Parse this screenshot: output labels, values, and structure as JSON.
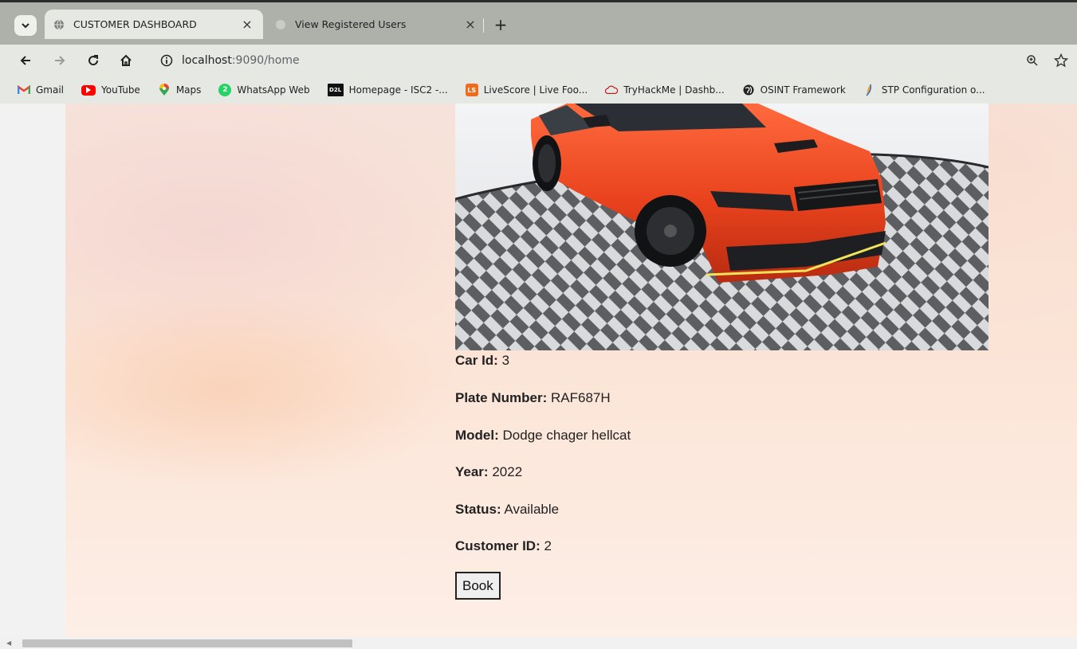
{
  "browser": {
    "tabs": [
      {
        "label": "CUSTOMER DASHBOARD",
        "active": true
      },
      {
        "label": "View Registered Users",
        "active": false
      }
    ],
    "close_glyph": "×",
    "new_tab_glyph": "+",
    "url_host": "localhost",
    "url_path": ":9090/home"
  },
  "bookmarks": [
    {
      "label": "Gmail",
      "icon": "gmail-icon",
      "color": "#ea4335"
    },
    {
      "label": "YouTube",
      "icon": "youtube-icon",
      "color": "#ff0000"
    },
    {
      "label": "Maps",
      "icon": "maps-icon",
      "color": "#fbbc04"
    },
    {
      "label": "WhatsApp Web",
      "icon": "whatsapp-icon",
      "color": "#25d366",
      "glyph": "2"
    },
    {
      "label": "Homepage - ISC2 -...",
      "icon": "d2l-icon",
      "color": "#111111",
      "glyph": "D2L"
    },
    {
      "label": "LiveScore | Live Foo...",
      "icon": "livescore-icon",
      "color": "#f26a1b",
      "glyph": "LS"
    },
    {
      "label": "TryHackMe | Dashb...",
      "icon": "tryhackme-icon",
      "color": "#c11111"
    },
    {
      "label": "OSINT Framework",
      "icon": "osint-icon",
      "color": "#222222"
    },
    {
      "label": "STP Configuration o...",
      "icon": "stp-icon",
      "color": "#2d6fd6"
    }
  ],
  "car": {
    "fields": [
      {
        "label": "Car Id:",
        "value": "3"
      },
      {
        "label": "Plate Number:",
        "value": "RAF687H"
      },
      {
        "label": "Model:",
        "value": "Dodge chager hellcat"
      },
      {
        "label": "Year:",
        "value": "2022"
      },
      {
        "label": "Status:",
        "value": "Available"
      },
      {
        "label": "Customer ID:",
        "value": "2"
      }
    ],
    "book_label": "Book",
    "body_color": "#e8421d"
  }
}
